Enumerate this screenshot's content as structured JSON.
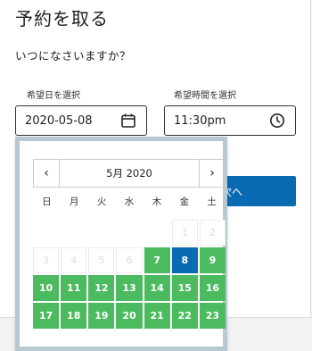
{
  "title": "予約を取る",
  "question": "いつになさいますか？",
  "date_field": {
    "label": "希望日を選択",
    "value": "2020-05-08",
    "icon": "calendar-icon"
  },
  "time_field": {
    "label": "希望時間を選択",
    "value": "11:30pm",
    "icon": "clock-icon"
  },
  "next_button": {
    "label": "次へ"
  },
  "picker": {
    "month_label": "5月 2020",
    "prev_label": "‹",
    "next_label": "›",
    "weekdays": [
      "日",
      "月",
      "火",
      "水",
      "木",
      "金",
      "土"
    ],
    "days": [
      {
        "label": "",
        "state": "empty"
      },
      {
        "label": "",
        "state": "empty"
      },
      {
        "label": "",
        "state": "empty"
      },
      {
        "label": "",
        "state": "empty"
      },
      {
        "label": "",
        "state": "empty"
      },
      {
        "label": "1",
        "state": "disabled"
      },
      {
        "label": "2",
        "state": "disabled"
      },
      {
        "label": "3",
        "state": "disabled"
      },
      {
        "label": "4",
        "state": "disabled"
      },
      {
        "label": "5",
        "state": "disabled"
      },
      {
        "label": "6",
        "state": "disabled"
      },
      {
        "label": "7",
        "state": "available"
      },
      {
        "label": "8",
        "state": "selected"
      },
      {
        "label": "9",
        "state": "available"
      },
      {
        "label": "10",
        "state": "available"
      },
      {
        "label": "11",
        "state": "available"
      },
      {
        "label": "12",
        "state": "available"
      },
      {
        "label": "13",
        "state": "available"
      },
      {
        "label": "14",
        "state": "available"
      },
      {
        "label": "15",
        "state": "available"
      },
      {
        "label": "16",
        "state": "available"
      },
      {
        "label": "17",
        "state": "available"
      },
      {
        "label": "18",
        "state": "available"
      },
      {
        "label": "19",
        "state": "available"
      },
      {
        "label": "20",
        "state": "available"
      },
      {
        "label": "21",
        "state": "available"
      },
      {
        "label": "22",
        "state": "available"
      },
      {
        "label": "23",
        "state": "available"
      }
    ]
  },
  "colors": {
    "available": "#4cbb5f",
    "selected": "#0a6ab2",
    "accent": "#0a6ab2"
  }
}
